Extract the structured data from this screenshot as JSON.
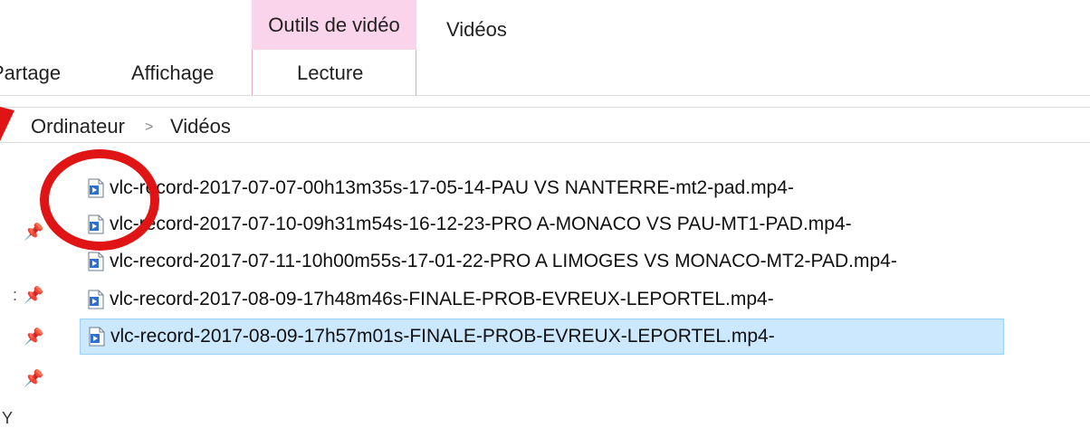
{
  "ribbon": {
    "context_tab": "Outils de vidéo",
    "videos_tab": "Vidéos",
    "tabs": [
      "Partage",
      "Affichage",
      "Lecture"
    ]
  },
  "address": {
    "crumbs": [
      "Ordinateur",
      "Vidéos"
    ],
    "separator": ">"
  },
  "files": [
    "vlc-record-2017-07-07-00h13m35s-17-05-14-PAU VS NANTERRE-mt2-pad.mp4-",
    "vlc-record-2017-07-10-09h31m54s-16-12-23-PRO A-MONACO VS PAU-MT1-PAD.mp4-",
    "vlc-record-2017-07-11-10h00m55s-17-01-22-PRO A LIMOGES VS MONACO-MT2-PAD.mp4-",
    "vlc-record-2017-08-09-17h48m46s-FINALE-PROB-EVREUX-LEPORTEL.mp4-",
    "vlc-record-2017-08-09-17h57m01s-FINALE-PROB-EVREUX-LEPORTEL.mp4-"
  ],
  "selected_file_index": 4,
  "sidebar": {
    "pin_icon": "pin-icon",
    "fragments": [
      ":",
      "Y"
    ]
  },
  "colors": {
    "context_tab": "#f9d4ea",
    "selection": "#cce8ff",
    "annotation": "#e01414"
  }
}
